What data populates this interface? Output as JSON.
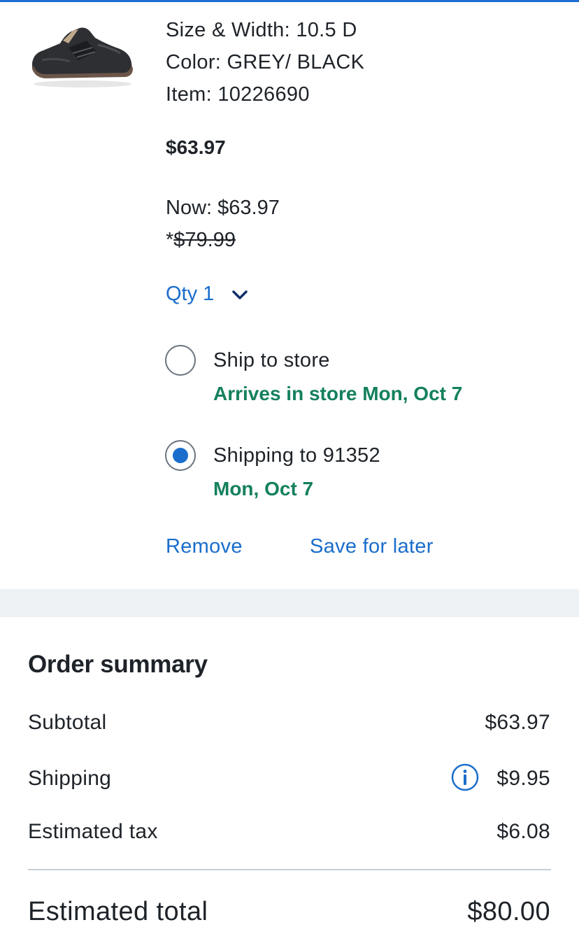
{
  "product": {
    "image_icon": "sneaker-product-image",
    "size_width": "Size & Width: 10.5 D",
    "color": "Color: GREY/ BLACK",
    "item": "Item: 10226690",
    "price": "$63.97",
    "now_price": "Now: $63.97",
    "was_prefix": "*",
    "was_price": "$79.99"
  },
  "quantity": {
    "label": "Qty 1",
    "icon": "chevron-down-icon"
  },
  "fulfillment": {
    "options": [
      {
        "label": "Ship to store",
        "detail": "Arrives in store Mon, Oct 7",
        "selected": false
      },
      {
        "label": "Shipping to 91352",
        "detail": "Mon, Oct 7",
        "selected": true
      }
    ]
  },
  "actions": {
    "remove": "Remove",
    "save_for_later": "Save for later"
  },
  "order_summary": {
    "title": "Order summary",
    "subtotal_label": "Subtotal",
    "subtotal_value": "$63.97",
    "shipping_label": "Shipping",
    "shipping_value": "$9.95",
    "shipping_info_icon": "info-icon",
    "tax_label": "Estimated tax",
    "tax_value": "$6.08",
    "total_label": "Estimated total",
    "total_value": "$80.00"
  },
  "colors": {
    "accent_blue": "#1a6dcb",
    "success_green": "#14805e",
    "text": "#1e2329",
    "band_gray": "#eef1f4"
  }
}
